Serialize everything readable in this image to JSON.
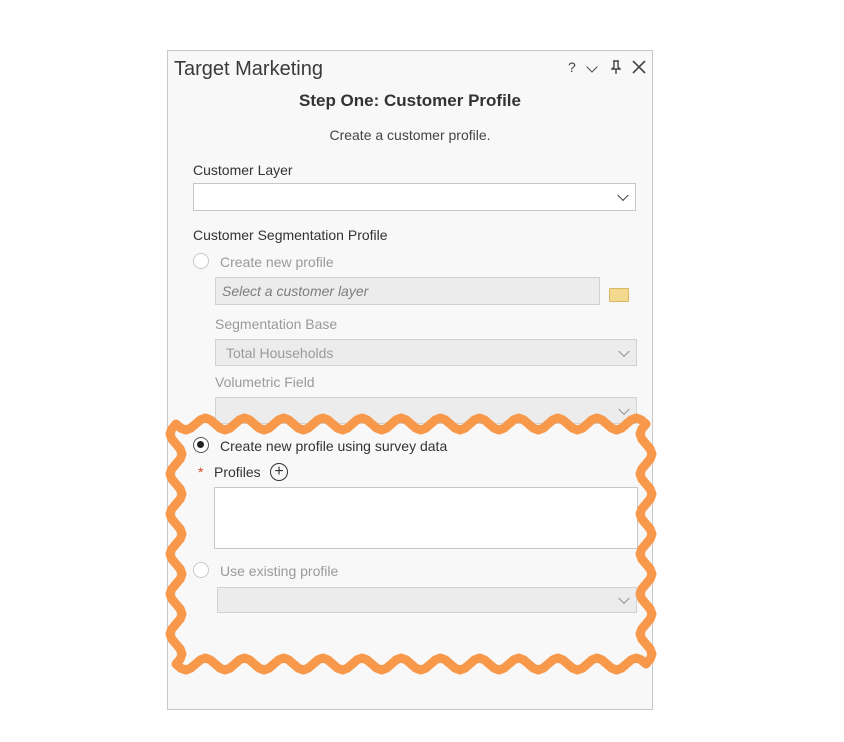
{
  "pane": {
    "title": "Target Marketing",
    "help_label": "?",
    "pin_glyph": "⚲",
    "close_glyph": "✕",
    "step_title": "Step One: Customer Profile",
    "step_subtitle": "Create a customer profile."
  },
  "customer_layer": {
    "label": "Customer Layer",
    "value": ""
  },
  "segmentation": {
    "label": "Customer Segmentation Profile",
    "option_create_new": "Create new profile",
    "layer_placeholder": "Select a customer layer",
    "base_label": "Segmentation Base",
    "base_value": "Total Households",
    "volumetric_label": "Volumetric Field",
    "volumetric_value": "",
    "option_survey": "Create new profile using survey data",
    "required_mark": "*",
    "profiles_label": "Profiles",
    "add_glyph": "+",
    "profiles_value": "",
    "option_existing": "Use existing profile",
    "existing_value": ""
  },
  "colors": {
    "highlight": "#f7984a",
    "required": "#d04e1f"
  },
  "icons": [
    "help-icon",
    "chevron-down-icon",
    "pin-icon",
    "close-icon",
    "folder-icon",
    "add-icon"
  ]
}
